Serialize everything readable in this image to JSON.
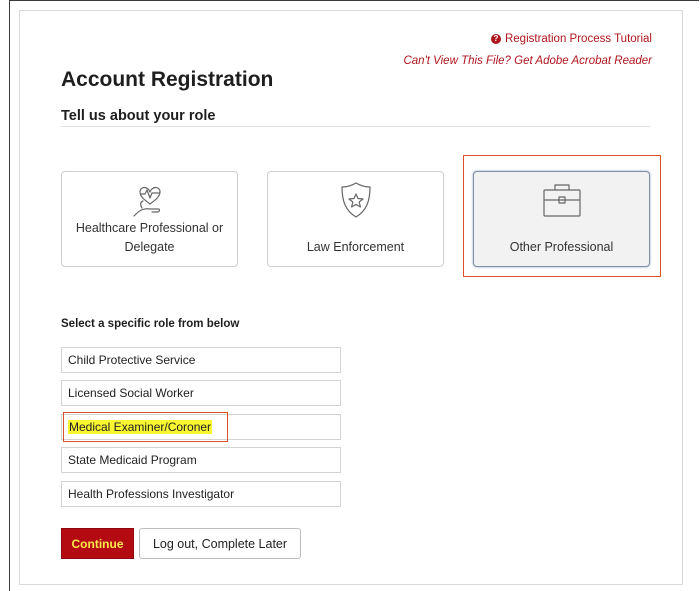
{
  "help": {
    "tutorial_label": "Registration Process Tutorial",
    "tutorial_icon": "question-circle-icon",
    "acrobat_label": "Can't View This File? Get Adobe Acrobat Reader"
  },
  "page": {
    "title": "Account Registration",
    "section_title": "Tell us about your role"
  },
  "role_cards": [
    {
      "label": "Healthcare Professional or Delegate",
      "icon": "heart-hand-icon"
    },
    {
      "label": "Law Enforcement",
      "icon": "shield-star-icon"
    },
    {
      "label": "Other Professional",
      "icon": "briefcase-icon",
      "selected": true
    }
  ],
  "specific_roles": {
    "title": "Select a specific role from below",
    "options": [
      "Child Protective Service",
      "Licensed Social Worker",
      "Medical Examiner/Coroner",
      "State Medicaid Program",
      "Health Professions Investigator"
    ],
    "highlighted": "Medical Examiner/Coroner"
  },
  "actions": {
    "continue_label": "Continue",
    "logout_label": "Log out, Complete Later"
  },
  "colors": {
    "brand_red": "#b40b13",
    "link_red": "#b0151e",
    "annotation_orange": "#d9502e",
    "highlight_yellow": "#f8f531",
    "continue_text": "#fde84a"
  }
}
